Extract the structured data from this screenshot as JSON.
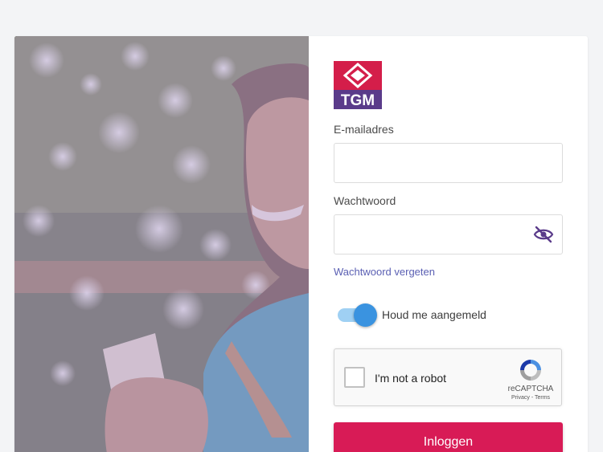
{
  "brand": {
    "logo_text": "TGM",
    "primary_color": "#d81b56",
    "logo_purple": "#5a3b8a",
    "logo_red": "#d41e4a",
    "hero_overlay": "#b9a6d8"
  },
  "form": {
    "email": {
      "label": "E-mailadres",
      "value": "",
      "placeholder": ""
    },
    "password": {
      "label": "Wachtwoord",
      "value": "",
      "placeholder": "",
      "toggle_icon": "eye-slash-icon"
    },
    "forgot_link": "Wachtwoord vergeten",
    "remember": {
      "label": "Houd me aangemeld",
      "checked": true,
      "color": "#3a93e0"
    },
    "captcha": {
      "checkbox_label": "I'm not a robot",
      "brand": "reCAPTCHA",
      "terms": "Privacy - Terms",
      "icon": "recaptcha-icon"
    },
    "submit_label": "Inloggen"
  }
}
